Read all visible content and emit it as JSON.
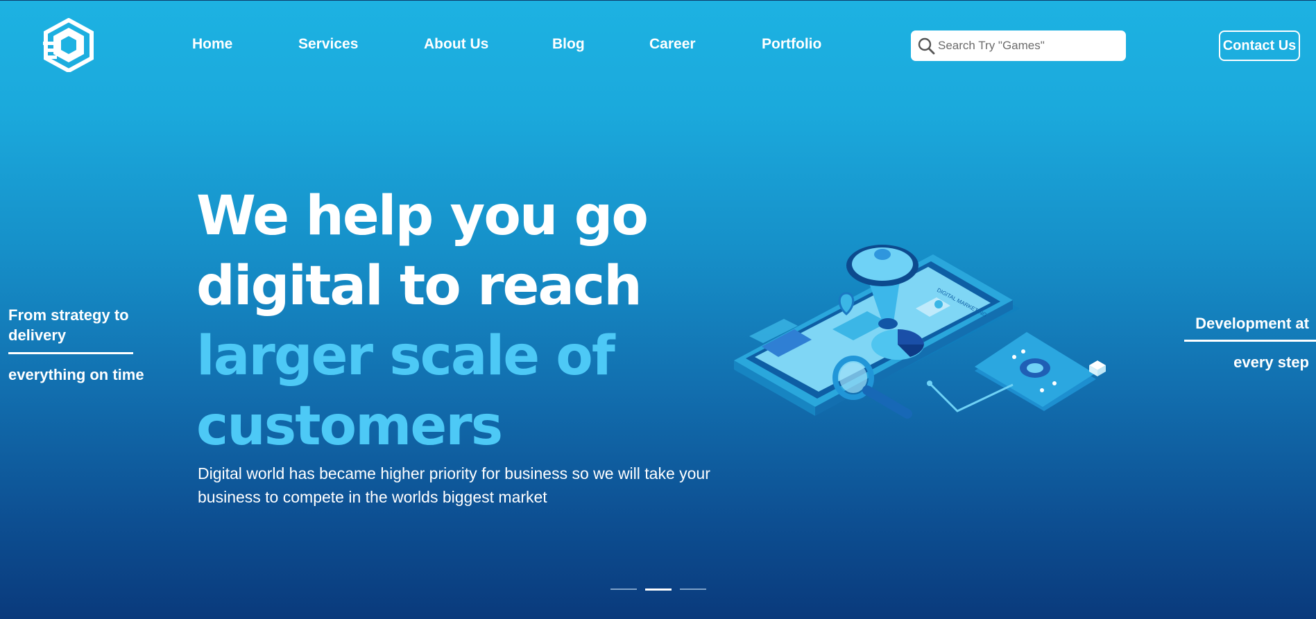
{
  "header": {
    "logo_name": "hexagon-cube-logo",
    "nav": [
      {
        "label": "Home"
      },
      {
        "label": "Services"
      },
      {
        "label": "About Us"
      },
      {
        "label": "Blog"
      },
      {
        "label": "Career"
      },
      {
        "label": "Portfolio"
      }
    ],
    "search": {
      "placeholder": "Search Try \"Games\"",
      "icon": "search-icon"
    },
    "contact_label": "Contact Us"
  },
  "left_tagline": {
    "line1": "From strategy to delivery",
    "line2": "everything on time"
  },
  "right_tagline": {
    "line1": "Development at",
    "line2": "every step"
  },
  "hero": {
    "title_lines": [
      {
        "text": "We help you go",
        "style": "white"
      },
      {
        "text": "digital to reach",
        "style": "white"
      },
      {
        "text": "larger scale of",
        "style": "accent"
      },
      {
        "text": "customers",
        "style": "accent"
      }
    ],
    "description": "Digital world has became higher priority for business so we will take your business to compete in the worlds biggest market",
    "illustration": "digital-marketing-phone-illustration",
    "phone_screen_label": "DIGITAL MARKETING"
  },
  "slider": {
    "count": 3,
    "active_index": 1
  },
  "colors": {
    "accent_text": "#4dc9f6",
    "background_top": "#1db2e2",
    "background_bottom": "#0a3a7c"
  }
}
